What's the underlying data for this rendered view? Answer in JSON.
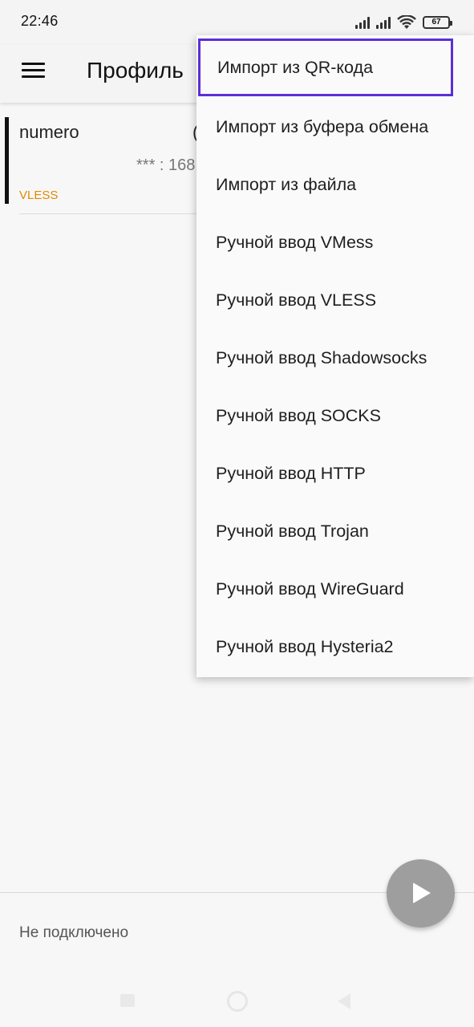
{
  "status_bar": {
    "time": "22:46",
    "battery_level": "67"
  },
  "app_bar": {
    "title": "Профиль",
    "menu_icon": "hamburger-menu-icon"
  },
  "profile": {
    "name": "numero",
    "address": "*** : 168",
    "type": "VLESS",
    "extra": "("
  },
  "dropdown": {
    "items": [
      {
        "label": "Импорт из QR-кода",
        "focused": true
      },
      {
        "label": "Импорт из буфера обмена"
      },
      {
        "label": "Импорт из файла"
      },
      {
        "label": "Ручной ввод VMess"
      },
      {
        "label": "Ручной ввод VLESS"
      },
      {
        "label": "Ручной ввод Shadowsocks"
      },
      {
        "label": "Ручной ввод SOCKS"
      },
      {
        "label": "Ручной ввод HTTP"
      },
      {
        "label": "Ручной ввод Trojan"
      },
      {
        "label": "Ручной ввод WireGuard"
      },
      {
        "label": "Ручной ввод Hysteria2"
      }
    ]
  },
  "footer": {
    "status_text": "Не подключено",
    "fab_icon": "play-icon"
  },
  "colors": {
    "accent_type": "#e08a00",
    "focus_outline": "#5b2fd6",
    "fab": "#9e9e9e"
  }
}
